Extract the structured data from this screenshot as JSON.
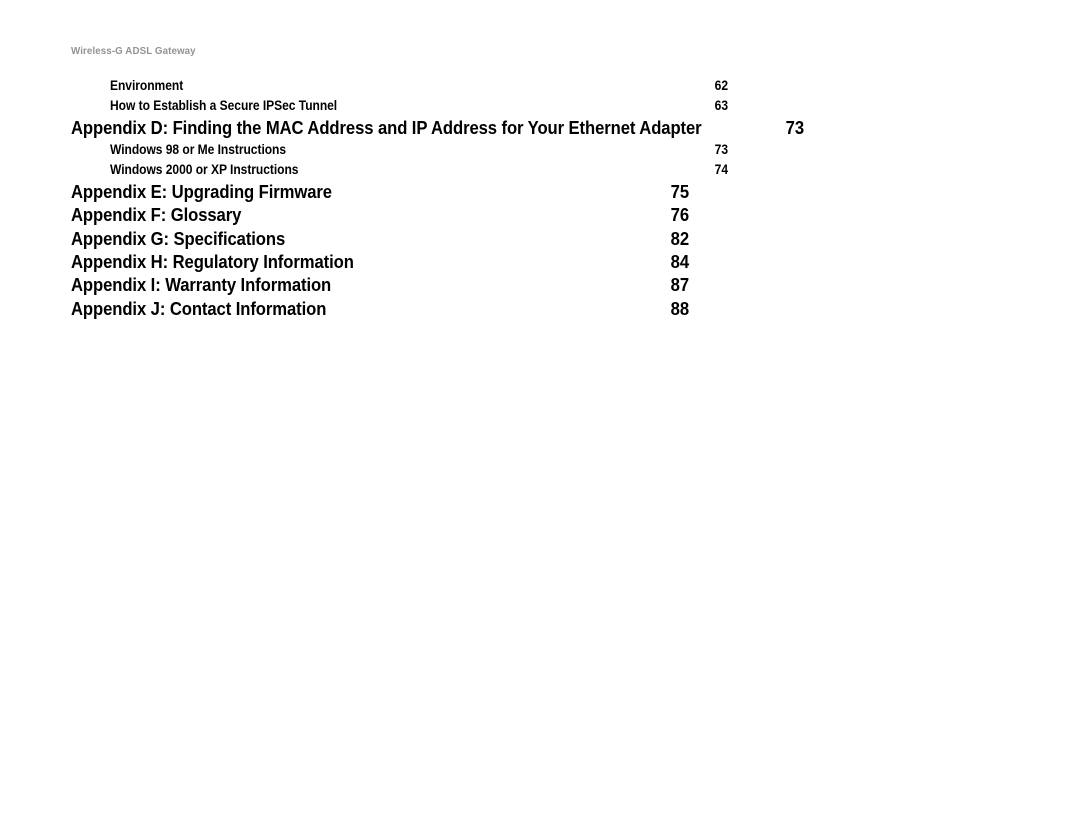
{
  "document": {
    "running_header": "Wireless-G ADSL Gateway"
  },
  "toc": {
    "entries": [
      {
        "title": "Environment",
        "page": "62",
        "level": 2
      },
      {
        "title": "How to Establish a Secure IPSec Tunnel",
        "page": "63",
        "level": 2
      },
      {
        "title": "Appendix D: Finding the MAC Address and IP Address for Your Ethernet Adapter",
        "page": "73",
        "level": 1
      },
      {
        "title": "Windows 98 or Me Instructions",
        "page": "73",
        "level": 2
      },
      {
        "title": "Windows 2000 or XP Instructions",
        "page": "74",
        "level": 2
      },
      {
        "title": "Appendix E: Upgrading Firmware",
        "page": "75",
        "level": 1
      },
      {
        "title": "Appendix F: Glossary",
        "page": "76",
        "level": 1
      },
      {
        "title": "Appendix G: Specifications",
        "page": "82",
        "level": 1
      },
      {
        "title": "Appendix H: Regulatory Information",
        "page": "84",
        "level": 1
      },
      {
        "title": "Appendix I: Warranty Information",
        "page": "87",
        "level": 1
      },
      {
        "title": "Appendix J: Contact Information",
        "page": "88",
        "level": 1
      }
    ]
  },
  "colors": {
    "page_background": "#ffffff",
    "body_text": "#000000",
    "running_header_text": "#939393"
  }
}
